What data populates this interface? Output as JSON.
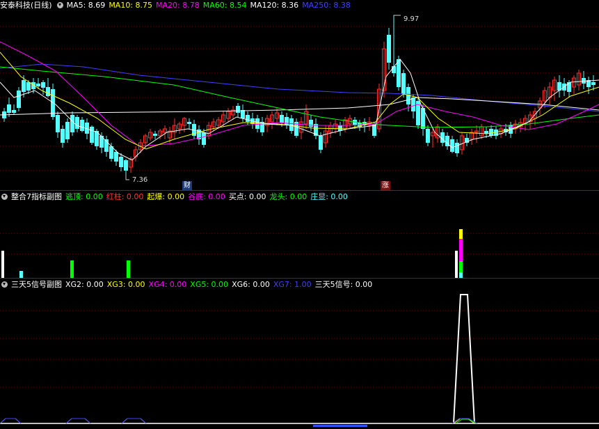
{
  "main": {
    "stock_name": "安泰科技(日线)",
    "ma": [
      {
        "label": "MA5: 8.69",
        "color": "#ffffff"
      },
      {
        "label": "MA10: 8.75",
        "color": "#ffff00"
      },
      {
        "label": "MA20: 8.78",
        "color": "#ff00ff"
      },
      {
        "label": "MA60: 8.54",
        "color": "#00ff00"
      },
      {
        "label": "MA120: 8.36",
        "color": "#ffffff"
      },
      {
        "label": "MA250: 8.38",
        "color": "#4040ff"
      }
    ],
    "high_label": "9.97",
    "low_label": "7.36",
    "event_cai": "财",
    "event_zhang": "涨",
    "colors": {
      "up": "#ff3030",
      "down": "#54ffff",
      "ma5": "#ffffff",
      "ma10": "#ffff00",
      "ma20": "#ff00ff",
      "ma60": "#00ff00",
      "ma120": "#ffffff",
      "ma250": "#4040ff"
    }
  },
  "sub1": {
    "title": "整合7指标副图",
    "items": [
      {
        "label": "逃顶: 0.00",
        "color": "#00ff00"
      },
      {
        "label": "红柱: 0.00",
        "color": "#ff3030"
      },
      {
        "label": "起爆: 0.00",
        "color": "#ffff00"
      },
      {
        "label": "谷底: 0.00",
        "color": "#ff00ff"
      },
      {
        "label": "买点: 0.00",
        "color": "#ffffff"
      },
      {
        "label": "龙头: 0.00",
        "color": "#00ff00"
      },
      {
        "label": "庄显: 0.00",
        "color": "#54ffff"
      }
    ]
  },
  "sub2": {
    "title": "三天5信号副图",
    "items": [
      {
        "label": "XG2: 0.00",
        "color": "#ffffff"
      },
      {
        "label": "XG3: 0.00",
        "color": "#ffff00"
      },
      {
        "label": "XG4: 0.00",
        "color": "#ff00ff"
      },
      {
        "label": "XG5: 0.00",
        "color": "#00ff00"
      },
      {
        "label": "XG6: 0.00",
        "color": "#ffffff"
      },
      {
        "label": "XG7: 1.00",
        "color": "#4040ff"
      },
      {
        "label": "三天5信号: 0.00",
        "color": "#ffffff"
      }
    ]
  }
}
